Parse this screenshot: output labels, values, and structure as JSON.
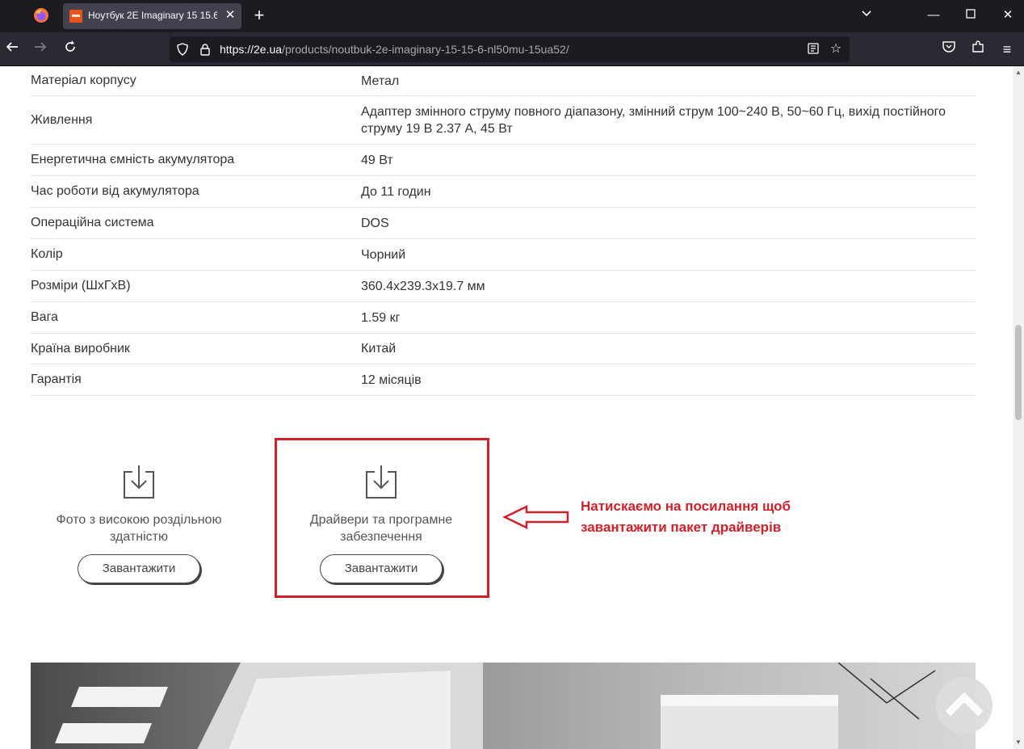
{
  "browser": {
    "tab_title": "Ноутбук 2E Imaginary 15 15.6\" |",
    "url_host": "https://2e.ua",
    "url_path": "/products/noutbuk-2e-imaginary-15-15-6-nl50mu-15ua52/"
  },
  "specs": [
    {
      "key": "Матеріал корпусу",
      "value": "Метал"
    },
    {
      "key": "Живлення",
      "value": "Адаптер змінного струму повного діапазону, змінний струм 100~240 В, 50~60 Гц, вихід постійного струму 19 В 2.37 А, 45 Вт"
    },
    {
      "key": "Енергетична ємність акумулятора",
      "value": "49 Вт"
    },
    {
      "key": "Час роботи від акумулятора",
      "value": "До 11 годин"
    },
    {
      "key": "Операційна система",
      "value": "DOS"
    },
    {
      "key": "Колір",
      "value": "Чорний"
    },
    {
      "key": "Розміри (ШхГхВ)",
      "value": "360.4x239.3x19.7 мм"
    },
    {
      "key": "Вага",
      "value": "1.59 кг"
    },
    {
      "key": "Країна виробник",
      "value": "Китай"
    },
    {
      "key": "Гарантія",
      "value": "12 місяців"
    }
  ],
  "downloads": [
    {
      "label": "Фото з високою роздільною здатністю",
      "button": "Завантажити"
    },
    {
      "label": "Драйвери та програмне забезпечення",
      "button": "Завантажити"
    }
  ],
  "annotation": {
    "text": "Натискаємо на посилання щоб завантажити пакет драйверів",
    "color": "#d0202a"
  }
}
